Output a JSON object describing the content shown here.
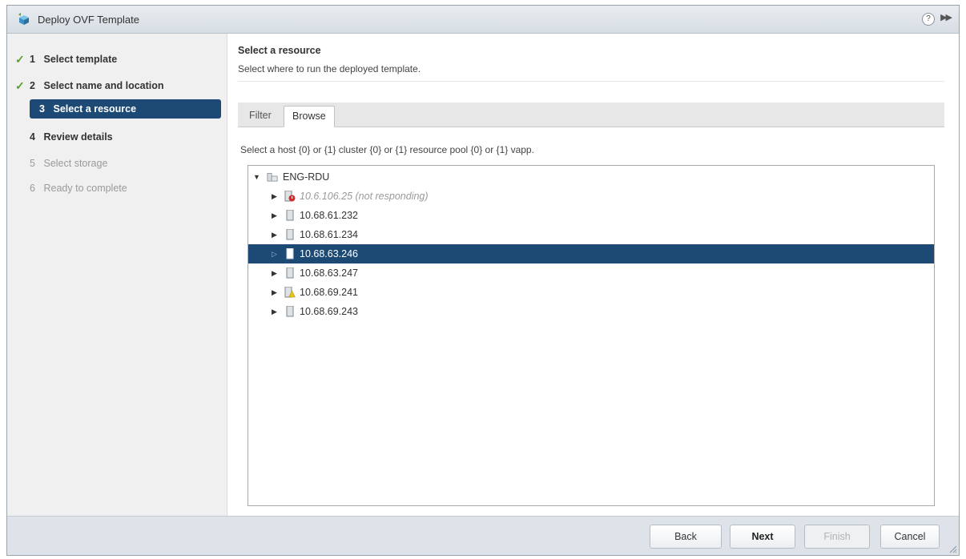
{
  "window": {
    "title": "Deploy OVF Template"
  },
  "steps": [
    {
      "num": "1",
      "label": "Select template",
      "state": "done"
    },
    {
      "num": "2",
      "label": "Select name and location",
      "state": "done"
    },
    {
      "num": "3",
      "label": "Select a resource",
      "state": "active"
    },
    {
      "num": "4",
      "label": "Review details",
      "state": "current"
    },
    {
      "num": "5",
      "label": "Select storage",
      "state": "disabled"
    },
    {
      "num": "6",
      "label": "Ready to complete",
      "state": "disabled"
    }
  ],
  "content": {
    "heading": "Select a resource",
    "subheading": "Select where to run the deployed template.",
    "tabs": {
      "filter": "Filter",
      "browse": "Browse"
    },
    "hint": "Select a host {0} or {1} cluster {0} or {1} resource pool {0} or {1} vapp."
  },
  "tree": {
    "root": "ENG-RDU",
    "hosts": [
      {
        "label": "10.6.106.25 (not responding)",
        "status": "error"
      },
      {
        "label": "10.68.61.232",
        "status": "normal"
      },
      {
        "label": "10.68.61.234",
        "status": "normal"
      },
      {
        "label": "10.68.63.246",
        "status": "selected"
      },
      {
        "label": "10.68.63.247",
        "status": "normal"
      },
      {
        "label": "10.68.69.241",
        "status": "warning"
      },
      {
        "label": "10.68.69.243",
        "status": "normal"
      }
    ]
  },
  "buttons": {
    "back": "Back",
    "next": "Next",
    "finish": "Finish",
    "cancel": "Cancel"
  },
  "colors": {
    "accent": "#1c4a75",
    "check": "#5aa02c",
    "error": "#d62b2b",
    "warning": "#e8c31c"
  }
}
